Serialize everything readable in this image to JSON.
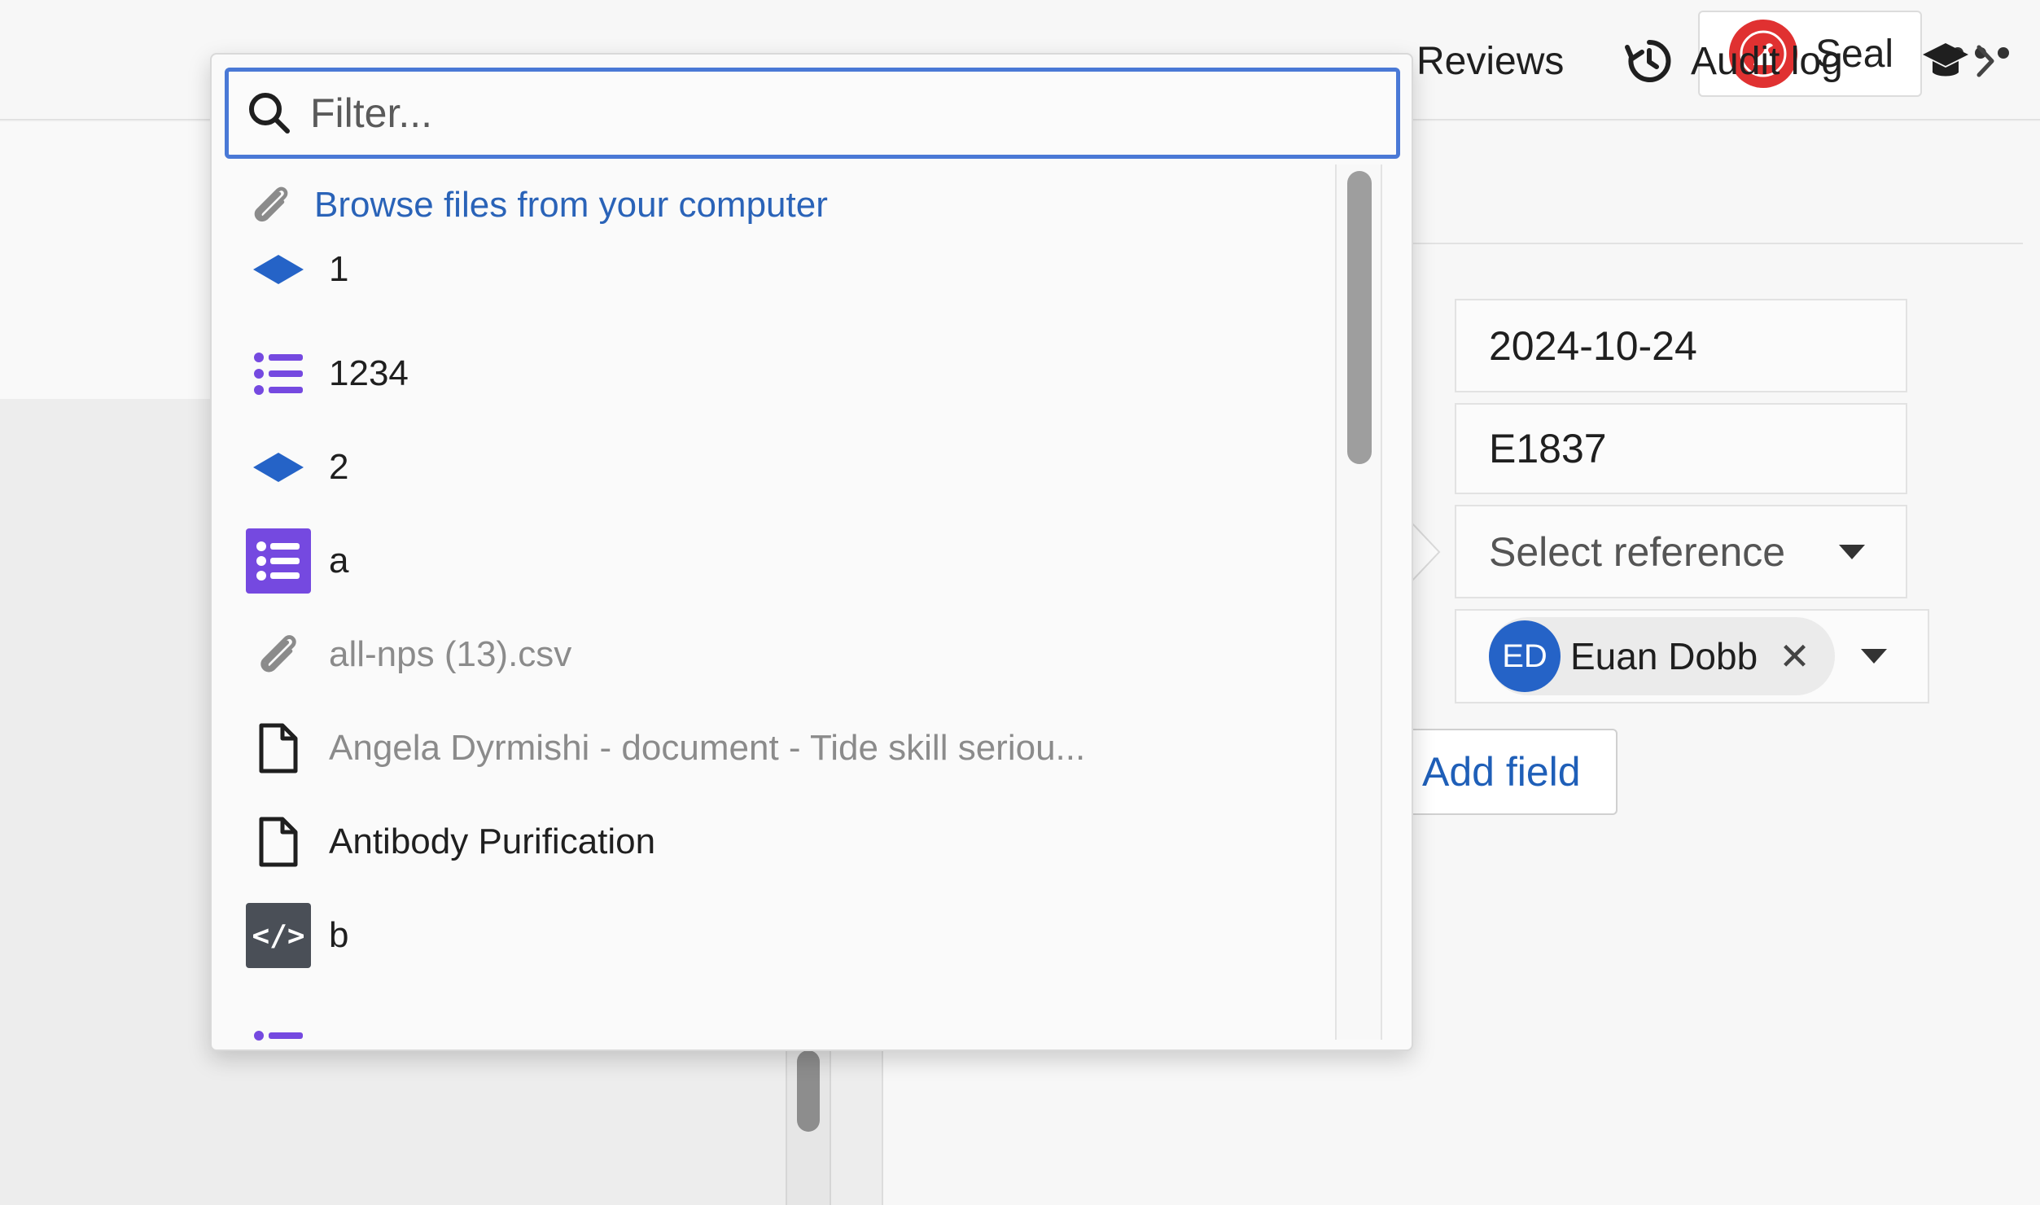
{
  "header": {
    "app_button_label": "Seal",
    "more_label": "More options"
  },
  "tabs": [
    {
      "label": "Reviews"
    },
    {
      "label": "Audit log"
    }
  ],
  "fields": {
    "date_value": "2024-10-24",
    "id_value": "E1837",
    "reference_placeholder": "Select reference",
    "assignee": {
      "initials": "ED",
      "name": "Euan Dobb",
      "remove_glyph": "✕"
    },
    "add_field_label": "Add field"
  },
  "dropdown": {
    "filter_placeholder": "Filter...",
    "browse_label": "Browse files from your computer",
    "items": [
      {
        "label": "1",
        "icon": "diamond-icon",
        "style": "normal"
      },
      {
        "label": "1234",
        "icon": "list-icon",
        "style": "normal"
      },
      {
        "label": "2",
        "icon": "diamond-icon",
        "style": "normal"
      },
      {
        "label": "a",
        "icon": "list-filled-icon",
        "style": "normal"
      },
      {
        "label": "all-nps (13).csv",
        "icon": "paperclip-icon",
        "style": "muted"
      },
      {
        "label": "Angela Dyrmishi - document - Tide skill seriou...",
        "icon": "document-icon",
        "style": "muted"
      },
      {
        "label": "Antibody Purification",
        "icon": "document-icon",
        "style": "normal"
      },
      {
        "label": "b",
        "icon": "code-icon",
        "style": "normal"
      }
    ]
  },
  "colors": {
    "accent_blue": "#2a63b8",
    "focus_border": "#4a79d6",
    "diamond_blue": "#2563c7",
    "list_purple": "#7549e0",
    "seal_red": "#e03131"
  }
}
